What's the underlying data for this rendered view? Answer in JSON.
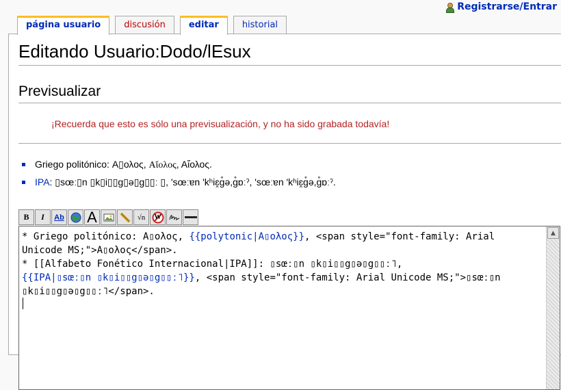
{
  "personal": {
    "login_label": "Registrarse/Entrar"
  },
  "tabs": [
    {
      "label": "página usuario"
    },
    {
      "label": "discusión"
    },
    {
      "label": "editar"
    },
    {
      "label": "historial"
    }
  ],
  "page": {
    "title": "Editando Usuario:Dodo/lEsux",
    "section_heading": "Previsualizar",
    "preview_warning": "¡Recuerda que esto es sólo una previsualización, y no ha sido grabada todavía!"
  },
  "preview_list": {
    "greek": {
      "label": "Griego politónico: ",
      "v1": "Α▯ολος",
      "sep1": ", ",
      "v2": "Αἴολος",
      "sep2": ", ",
      "v3": "Αἴολος",
      "end": "."
    },
    "ipa": {
      "link": "IPA",
      "rest": ": ▯sœː▯n ▯k▯i▯▯g▯ə▯g▯▯ː ▯, 'sœːɐn 'kʰiɛ̯ɡ̊ə,ɡ̊ɒːˀ, 'sœːɐn 'kʰiɛ̯ɡ̊ə,ɡ̊ɒːˀ."
    }
  },
  "toolbar": {
    "bold": "B",
    "italic": "I",
    "link": "Ab",
    "font": "A",
    "math": "√n",
    "nowiki": "W"
  },
  "editor": {
    "l1a": "* Griego politónico: Α▯ολος, ",
    "l1b": "{{polytonic|Α▯ολος}}",
    "l1c": ", <span style=\"font-family: Arial Unicode MS;\">Α▯ολος</span>.\n* [[Alfabeto Fonético Internacional|IPA]]: ▯sœː▯n ▯k▯i▯▯g▯ə▯g▯▯ː˥,\n",
    "l2": "{{IPA|▯sœː▯n ▯k▯i▯▯g▯ə▯g▯▯ː˥}}",
    "l3": ", <span style=\"font-family: Arial Unicode MS;\">▯sœː▯n ▯k▯i▯▯g▯ə▯g▯▯ː˥</span>."
  }
}
